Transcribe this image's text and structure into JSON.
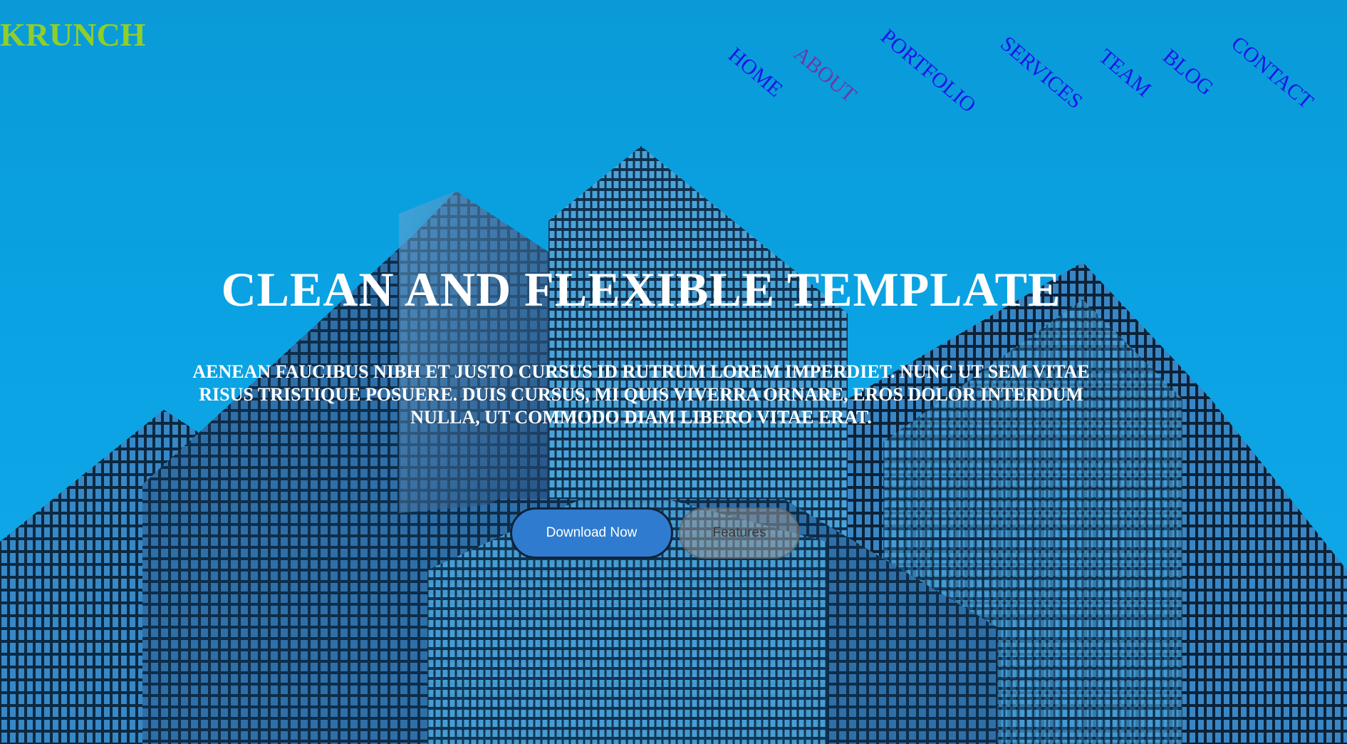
{
  "brand": {
    "logo": "KRUNCH"
  },
  "nav": {
    "items": [
      {
        "label": "HOME"
      },
      {
        "label": "ABOUT"
      },
      {
        "label": "PORTFOLIO"
      },
      {
        "label": "SERVICES"
      },
      {
        "label": "TEAM"
      },
      {
        "label": "BLOG"
      },
      {
        "label": "CONTACT"
      }
    ]
  },
  "hero": {
    "title": "CLEAN AND FLEXIBLE TEMPLATE",
    "subtitle": "AENEAN FAUCIBUS NIBH ET JUSTO CURSUS ID RUTRUM LOREM IMPERDIET. NUNC UT SEM VITAE RISUS TRISTIQUE POSUERE. DUIS CURSUS, MI QUIS VIVERRA ORNARE, EROS DOLOR INTERDUM NULLA, UT COMMODO DIAM LIBERO VITAE ERAT.",
    "primary_button": "Download Now",
    "secondary_button": "Features"
  },
  "colors": {
    "sky": "#0aa2e2",
    "logo": "#8fcf2a",
    "nav_link": "#1a17e8",
    "nav_link_visited": "#6b3aa8",
    "primary_button": "#2f7bcf"
  }
}
